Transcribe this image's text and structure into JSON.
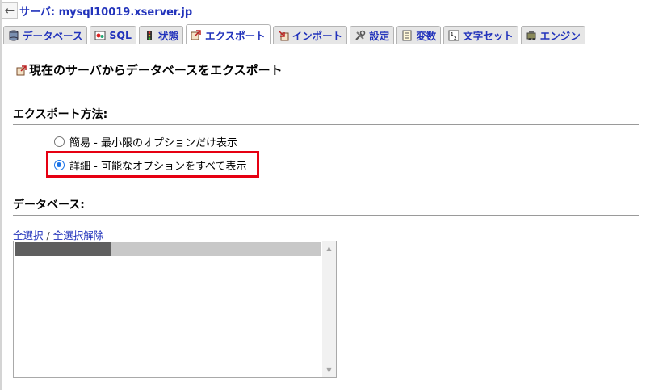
{
  "server": {
    "label": "サーバ: mysql10019.xserver.jp",
    "back_glyph": "←"
  },
  "tabs": [
    {
      "label": "データベース",
      "icon": "database-icon",
      "active": false
    },
    {
      "label": "SQL",
      "icon": "sql-icon",
      "active": false
    },
    {
      "label": "状態",
      "icon": "status-icon",
      "active": false
    },
    {
      "label": "エクスポート",
      "icon": "export-icon",
      "active": true
    },
    {
      "label": "インポート",
      "icon": "import-icon",
      "active": false
    },
    {
      "label": "設定",
      "icon": "settings-icon",
      "active": false
    },
    {
      "label": "変数",
      "icon": "variables-icon",
      "active": false
    },
    {
      "label": "文字セット",
      "icon": "charset-icon",
      "active": false
    },
    {
      "label": "エンジン",
      "icon": "engine-icon",
      "active": false
    }
  ],
  "page": {
    "title": "現在のサーバからデータベースをエクスポート"
  },
  "export_method": {
    "heading": "エクスポート方法:",
    "options": [
      {
        "label": "簡易 - 最小限のオプションだけ表示",
        "checked": false
      },
      {
        "label": "詳細 - 可能なオプションをすべて表示",
        "checked": true
      }
    ],
    "highlight_color": "#e60012"
  },
  "database": {
    "heading": "データベース:",
    "select_all": "全選択",
    "separator": "/",
    "deselect_all": "全選択解除"
  },
  "colors": {
    "link": "#2233bb",
    "radio_checked": "#1a73e8"
  }
}
